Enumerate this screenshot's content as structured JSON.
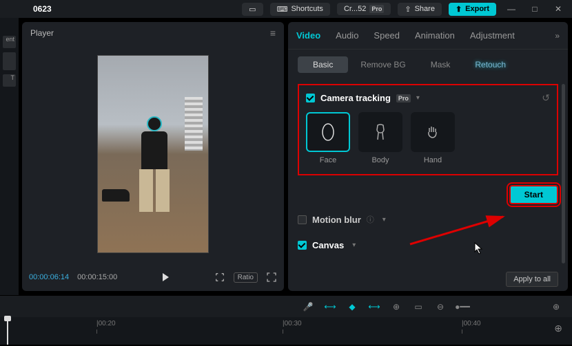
{
  "topbar": {
    "title": "0623",
    "shortcuts": "Shortcuts",
    "project": "Cr...52",
    "share": "Share",
    "export": "Export"
  },
  "left_dock": {
    "item1": "ent",
    "item2": "T"
  },
  "player": {
    "label": "Player",
    "current_time": "00:00:06:14",
    "duration": "00:00:15:00",
    "ratio": "Ratio"
  },
  "inspector": {
    "tabs": {
      "video": "Video",
      "audio": "Audio",
      "speed": "Speed",
      "animation": "Animation",
      "adjustment": "Adjustment"
    },
    "subtabs": {
      "basic": "Basic",
      "removebg": "Remove BG",
      "mask": "Mask",
      "retouch": "Retouch"
    },
    "camera_tracking": {
      "title": "Camera tracking",
      "pro": "Pro",
      "face": "Face",
      "body": "Body",
      "hand": "Hand"
    },
    "start": "Start",
    "motion_blur": "Motion blur",
    "canvas": "Canvas",
    "apply_all": "Apply to all"
  },
  "timeline": {
    "t1": "|00:20",
    "t2": "|00:30",
    "t3": "|00:40"
  }
}
